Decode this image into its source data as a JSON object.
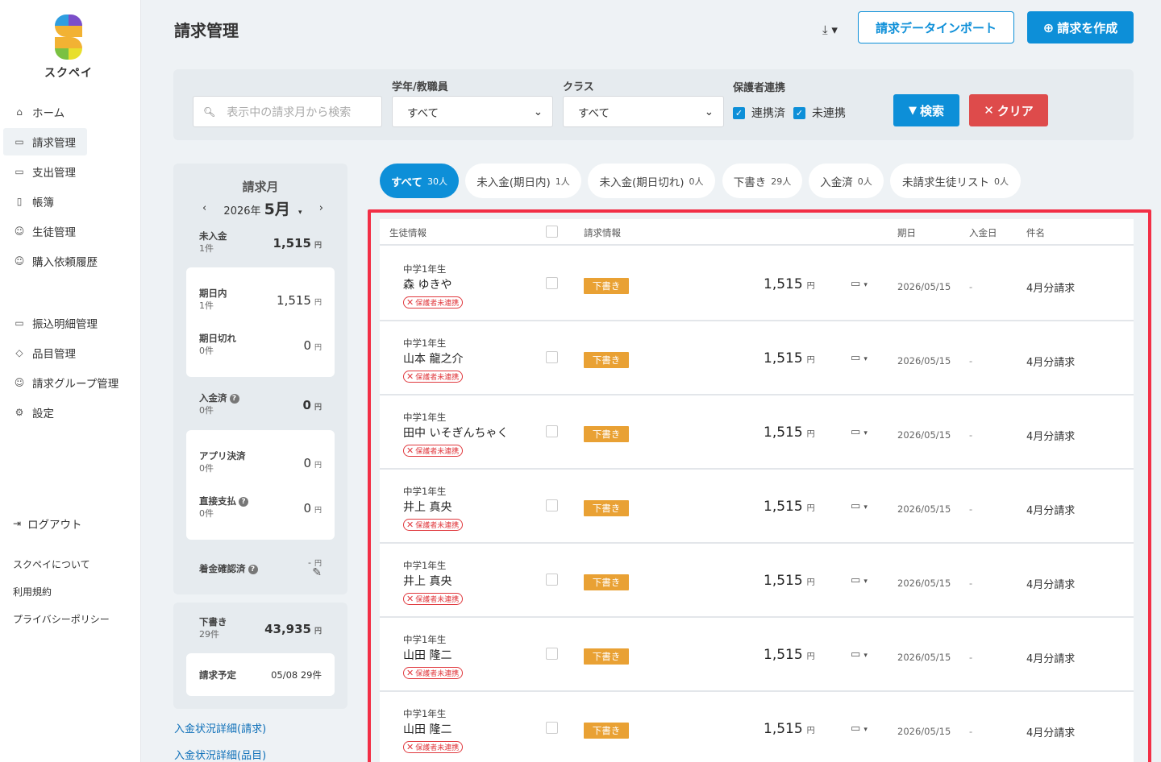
{
  "app": {
    "logo_text": "スクペイ",
    "brand_colors": [
      "#7b4fc9",
      "#2f9ee0",
      "#f2b233",
      "#7ac142"
    ]
  },
  "sidebar": {
    "items": [
      {
        "label": "ホーム",
        "icon": "home-icon",
        "glyph": "⌂"
      },
      {
        "label": "請求管理",
        "icon": "billing-icon",
        "glyph": "▭"
      },
      {
        "label": "支出管理",
        "icon": "expense-icon",
        "glyph": "▭"
      },
      {
        "label": "帳簿",
        "icon": "book-icon",
        "glyph": "▯"
      },
      {
        "label": "生徒管理",
        "icon": "student-icon",
        "glyph": "☺"
      },
      {
        "label": "購入依頼履歴",
        "icon": "purchase-icon",
        "glyph": "☺"
      }
    ],
    "items2": [
      {
        "label": "振込明細管理",
        "icon": "transfer-icon",
        "glyph": "▭"
      },
      {
        "label": "品目管理",
        "icon": "tag-icon",
        "glyph": "◇"
      },
      {
        "label": "請求グループ管理",
        "icon": "group-icon",
        "glyph": "☺"
      },
      {
        "label": "設定",
        "icon": "gear-icon",
        "glyph": "⚙"
      }
    ],
    "logout": "ログアウト",
    "footer": [
      "スクペイについて",
      "利用規約",
      "プライバシーポリシー"
    ]
  },
  "header": {
    "title": "請求管理",
    "download_glyph": "⤓ ▾",
    "import_label": "請求データインポート",
    "create_label": "請求を作成",
    "create_glyph": "⊕"
  },
  "filter": {
    "search_placeholder": "表示中の請求月から検索",
    "grade_label": "学年/教職員",
    "grade_value": "すべて",
    "class_label": "クラス",
    "class_value": "すべて",
    "guardian_label": "保護者連携",
    "linked_label": "連携済",
    "unlinked_label": "未連携",
    "search_btn": "検索",
    "clear_btn": "クリア"
  },
  "summary": {
    "title": "請求月",
    "year": "2026年",
    "month": "5月",
    "unpaid_label": "未入金",
    "unpaid_count": "1件",
    "unpaid_amount": "1,515",
    "within_label": "期日内",
    "within_count": "1件",
    "within_amount": "1,515",
    "overdue_label": "期日切れ",
    "overdue_count": "0件",
    "overdue_amount": "0",
    "paid_label": "入金済",
    "paid_count": "0件",
    "paid_amount": "0",
    "app_label": "アプリ決済",
    "app_count": "0件",
    "app_amount": "0",
    "direct_label": "直接支払",
    "direct_count": "0件",
    "direct_amount": "0",
    "confirm_label": "着金確認済",
    "confirm_amount": "-",
    "draft_label": "下書き",
    "draft_count": "29件",
    "draft_amount": "43,935",
    "scheduled_label": "請求予定",
    "scheduled_value": "05/08 29件",
    "yen": "円",
    "links": [
      "入金状況詳細(請求)",
      "入金状況詳細(品目)"
    ]
  },
  "tabs": [
    {
      "label": "すべて",
      "count": "30人"
    },
    {
      "label": "未入金(期日内)",
      "count": "1人"
    },
    {
      "label": "未入金(期日切れ)",
      "count": "0人"
    },
    {
      "label": "下書き",
      "count": "29人"
    },
    {
      "label": "入金済",
      "count": "0人"
    },
    {
      "label": "未請求生徒リスト",
      "count": "0人"
    }
  ],
  "table": {
    "headers": {
      "student": "生徒情報",
      "billing": "請求情報",
      "due": "期日",
      "paid": "入金日",
      "subject": "件名"
    },
    "rows": [
      {
        "grade": "中学1年生",
        "name": "森 ゆきや",
        "tag": "保護者未連携",
        "status": "下書き",
        "amount": "1,515",
        "due": "2026/05/15",
        "paid": "-",
        "subject": "4月分請求"
      },
      {
        "grade": "中学1年生",
        "name": "山本 龍之介",
        "tag": "保護者未連携",
        "status": "下書き",
        "amount": "1,515",
        "due": "2026/05/15",
        "paid": "-",
        "subject": "4月分請求"
      },
      {
        "grade": "中学1年生",
        "name": "田中 いそぎんちゃく",
        "tag": "保護者未連携",
        "status": "下書き",
        "amount": "1,515",
        "due": "2026/05/15",
        "paid": "-",
        "subject": "4月分請求"
      },
      {
        "grade": "中学1年生",
        "name": "井上 真央",
        "tag": "保護者未連携",
        "status": "下書き",
        "amount": "1,515",
        "due": "2026/05/15",
        "paid": "-",
        "subject": "4月分請求"
      },
      {
        "grade": "中学1年生",
        "name": "井上 真央",
        "tag": "保護者未連携",
        "status": "下書き",
        "amount": "1,515",
        "due": "2026/05/15",
        "paid": "-",
        "subject": "4月分請求"
      },
      {
        "grade": "中学1年生",
        "name": "山田 隆二",
        "tag": "保護者未連携",
        "status": "下書き",
        "amount": "1,515",
        "due": "2026/05/15",
        "paid": "-",
        "subject": "4月分請求"
      },
      {
        "grade": "中学1年生",
        "name": "山田 隆二",
        "tag": "保護者未連携",
        "status": "下書き",
        "amount": "1,515",
        "due": "2026/05/15",
        "paid": "-",
        "subject": "4月分請求"
      }
    ]
  }
}
